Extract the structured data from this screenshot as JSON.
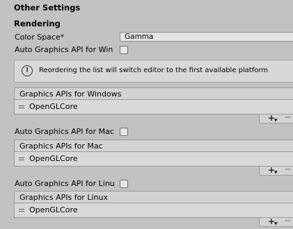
{
  "section_title": "Other Settings",
  "rendering": {
    "header": "Rendering",
    "color_space": {
      "label": "Color Space*",
      "value": "Gamma"
    },
    "auto_api_windows": {
      "label": "Auto Graphics API for Win",
      "checked": false
    },
    "help_message": "Reordering the list will switch editor to the first available platform",
    "lists": [
      {
        "header": "Graphics APIs for Windows",
        "items": [
          "OpenGLCore"
        ],
        "add": "+",
        "remove": "−"
      },
      {
        "header": "Graphics APIs for Mac",
        "items": [
          "OpenGLCore"
        ],
        "add": "+",
        "remove": "−"
      },
      {
        "header": "Graphics APIs for Linux",
        "items": [
          "OpenGLCore"
        ],
        "add": "+",
        "remove": "−"
      }
    ],
    "auto_api_mac": {
      "label": "Auto Graphics API for Mac",
      "checked": false
    },
    "auto_api_linux": {
      "label": "Auto Graphics API for Linu",
      "checked": false
    }
  },
  "icons": {
    "info": "info-icon",
    "drag": "drag-handle-icon",
    "add": "plus-icon",
    "remove": "minus-icon"
  }
}
